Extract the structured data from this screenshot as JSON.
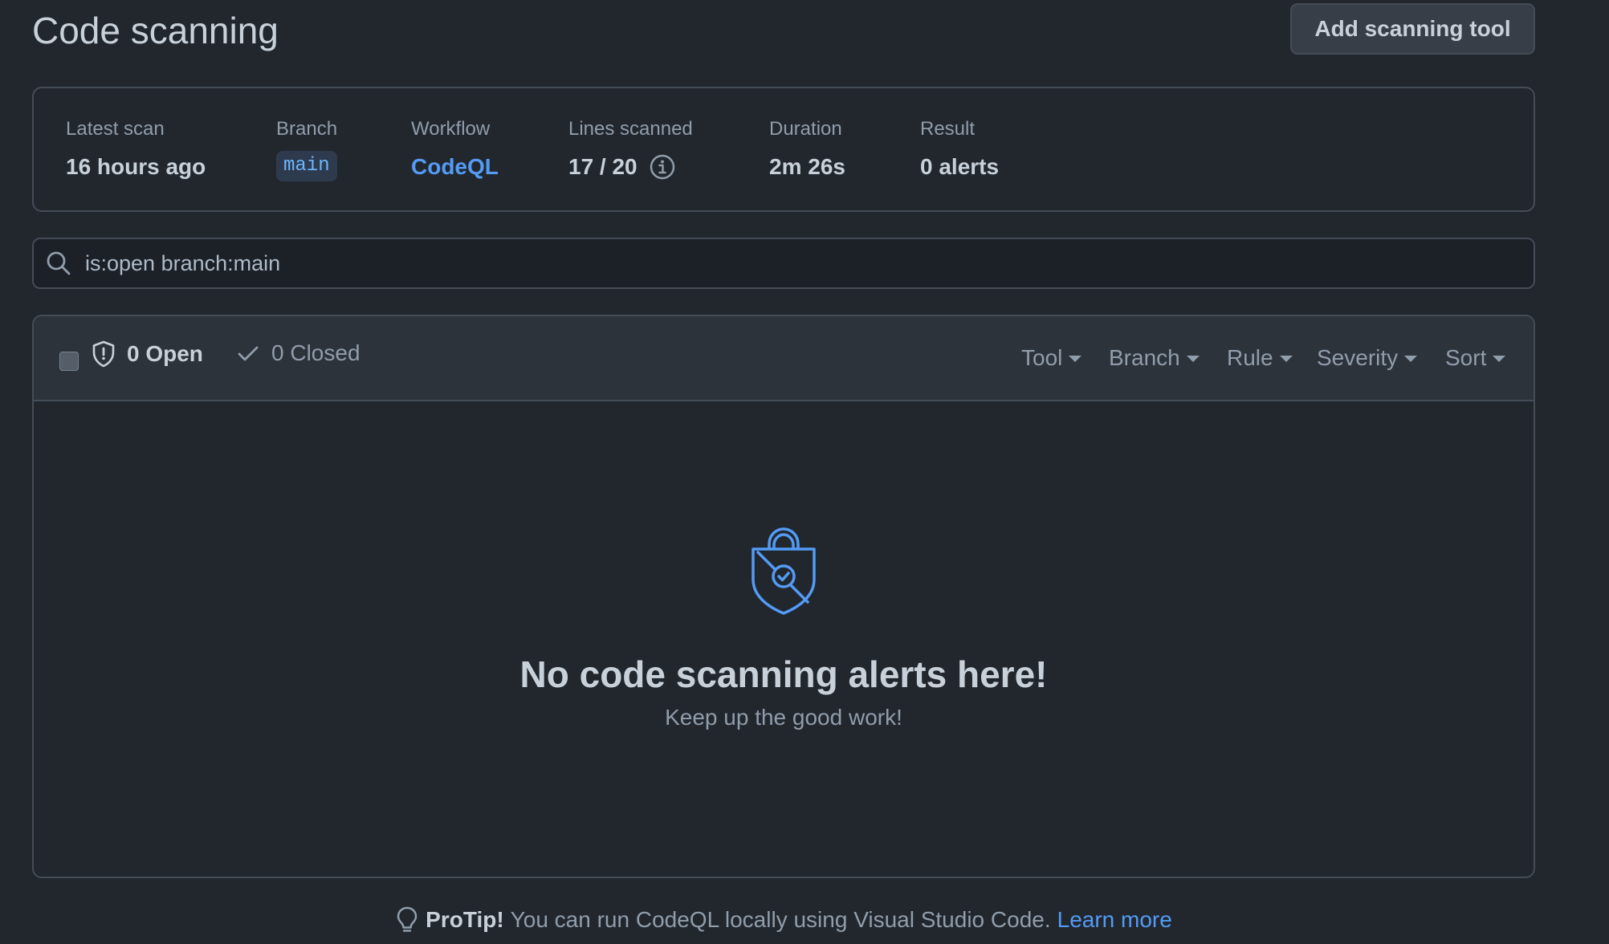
{
  "header": {
    "title": "Code scanning",
    "add_tool_label": "Add scanning tool"
  },
  "summary": {
    "latest_scan": {
      "label": "Latest scan",
      "value": "16 hours ago"
    },
    "branch": {
      "label": "Branch",
      "value": "main"
    },
    "workflow": {
      "label": "Workflow",
      "value": "CodeQL"
    },
    "lines_scanned": {
      "label": "Lines scanned",
      "value": "17 / 20"
    },
    "duration": {
      "label": "Duration",
      "value": "2m 26s"
    },
    "result": {
      "label": "Result",
      "value": "0 alerts"
    }
  },
  "search": {
    "value": "is:open branch:main"
  },
  "alerts": {
    "open_label": "0 Open",
    "closed_label": "0 Closed",
    "filters": {
      "tool": "Tool",
      "branch": "Branch",
      "rule": "Rule",
      "severity": "Severity",
      "sort": "Sort"
    },
    "empty_title": "No code scanning alerts here!",
    "empty_subtitle": "Keep up the good work!"
  },
  "protip": {
    "strong": "ProTip!",
    "text": "You can run CodeQL locally using Visual Studio Code.",
    "link": "Learn more"
  },
  "colors": {
    "background": "#22272e",
    "accent": "#539bf5",
    "border": "#444c56"
  }
}
